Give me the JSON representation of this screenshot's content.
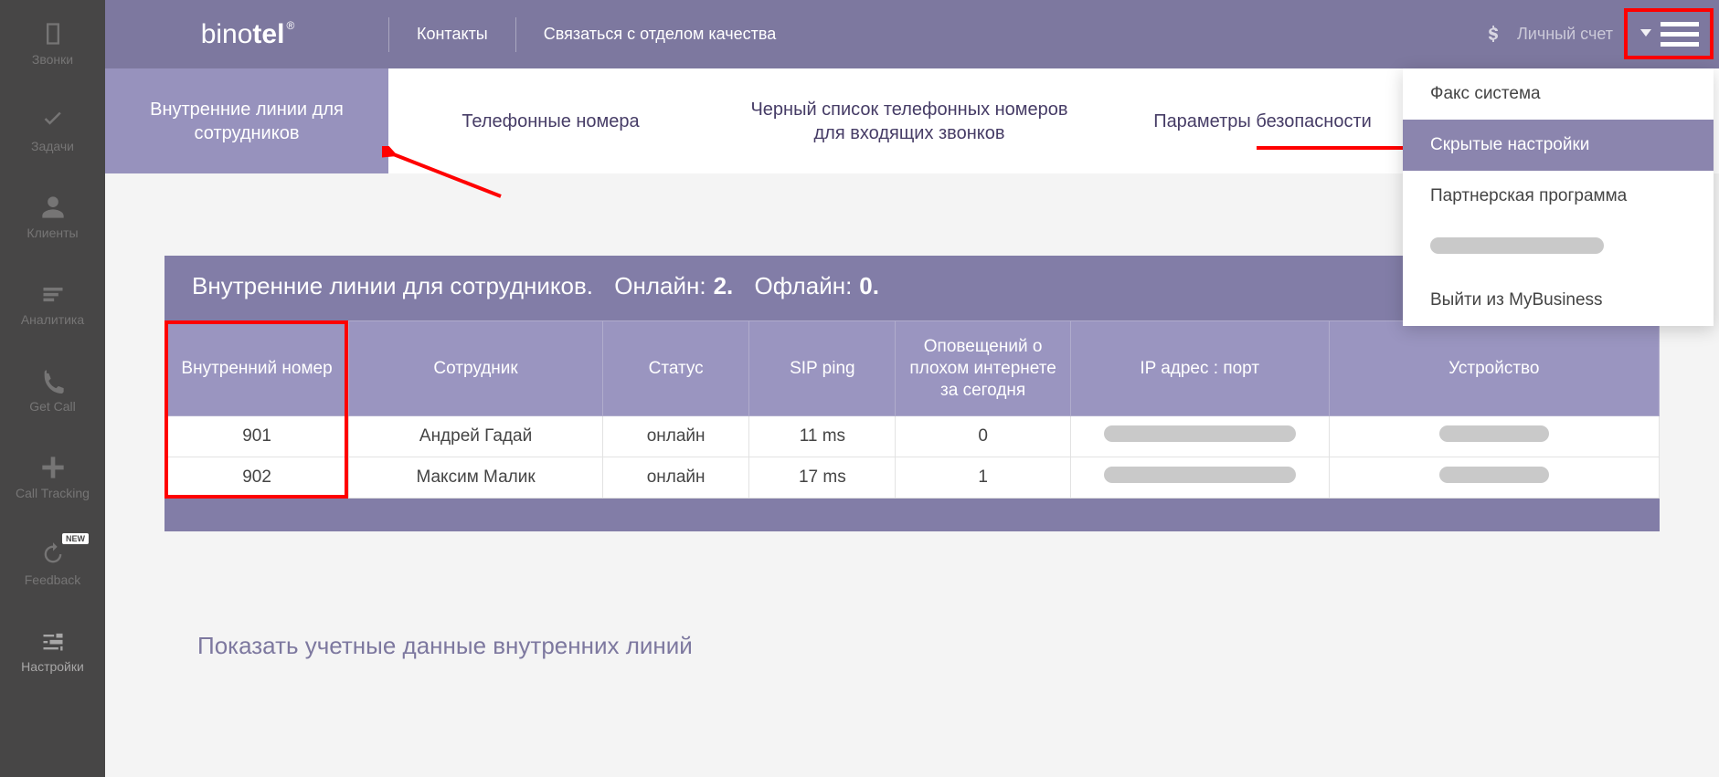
{
  "brand": {
    "part1": "bino",
    "part2": "tel"
  },
  "topnav": {
    "contacts": "Контакты",
    "quality": "Связаться с отделом качества",
    "account": "Личный счет"
  },
  "sidebar": {
    "items": [
      {
        "label": "Звонки",
        "icon": "phone"
      },
      {
        "label": "Задачи",
        "icon": "check"
      },
      {
        "label": "Клиенты",
        "icon": "user"
      },
      {
        "label": "Аналитика",
        "icon": "bars"
      },
      {
        "label": "Get Call",
        "icon": "handset"
      },
      {
        "label": "Call Tracking",
        "icon": "plus"
      },
      {
        "label": "Feedback",
        "icon": "refresh",
        "new": "NEW"
      },
      {
        "label": "Настройки",
        "icon": "sliders"
      }
    ]
  },
  "tabs": [
    {
      "label": "Внутренние линии для сотрудников",
      "active": true
    },
    {
      "label": "Телефонные номера"
    },
    {
      "label": "Черный список телефонных номеров для входящих звонков"
    },
    {
      "label": "Параметры безопасности"
    }
  ],
  "dropdown": {
    "items": [
      {
        "label": "Факс система"
      },
      {
        "label": "Скрытые настройки",
        "active": true
      },
      {
        "label": "Партнерская программа"
      },
      {
        "redacted": true
      },
      {
        "label": "Выйти из MyBusiness"
      }
    ]
  },
  "panel": {
    "title": "Внутренние линии для сотрудников.",
    "online_label": "Онлайн:",
    "online_value": "2.",
    "offline_label": "Офлайн:",
    "offline_value": "0.",
    "columns": [
      "Внутренний номер",
      "Сотрудник",
      "Статус",
      "SIP ping",
      "Оповещений о плохом интернете за сегодня",
      "IP адрес : порт",
      "Устройство"
    ],
    "rows": [
      {
        "ext": "901",
        "employee": "Андрей Гадай",
        "status": "онлайн",
        "ping": "11 ms",
        "alerts": "0"
      },
      {
        "ext": "902",
        "employee": "Максим Малик",
        "status": "онлайн",
        "ping": "17 ms",
        "alerts": "1"
      }
    ]
  },
  "below_link": "Показать учетные данные внутренних линий"
}
